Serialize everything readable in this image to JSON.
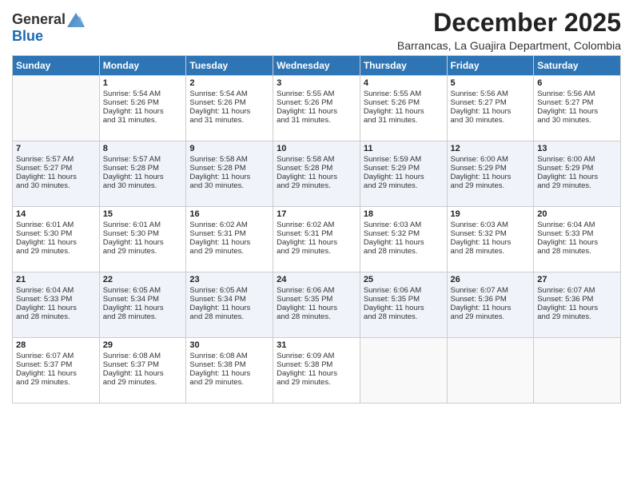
{
  "logo": {
    "general": "General",
    "blue": "Blue"
  },
  "title": "December 2025",
  "location": "Barrancas, La Guajira Department, Colombia",
  "days_header": [
    "Sunday",
    "Monday",
    "Tuesday",
    "Wednesday",
    "Thursday",
    "Friday",
    "Saturday"
  ],
  "weeks": [
    [
      {
        "day": "",
        "lines": []
      },
      {
        "day": "1",
        "lines": [
          "Sunrise: 5:54 AM",
          "Sunset: 5:26 PM",
          "Daylight: 11 hours",
          "and 31 minutes."
        ]
      },
      {
        "day": "2",
        "lines": [
          "Sunrise: 5:54 AM",
          "Sunset: 5:26 PM",
          "Daylight: 11 hours",
          "and 31 minutes."
        ]
      },
      {
        "day": "3",
        "lines": [
          "Sunrise: 5:55 AM",
          "Sunset: 5:26 PM",
          "Daylight: 11 hours",
          "and 31 minutes."
        ]
      },
      {
        "day": "4",
        "lines": [
          "Sunrise: 5:55 AM",
          "Sunset: 5:26 PM",
          "Daylight: 11 hours",
          "and 31 minutes."
        ]
      },
      {
        "day": "5",
        "lines": [
          "Sunrise: 5:56 AM",
          "Sunset: 5:27 PM",
          "Daylight: 11 hours",
          "and 30 minutes."
        ]
      },
      {
        "day": "6",
        "lines": [
          "Sunrise: 5:56 AM",
          "Sunset: 5:27 PM",
          "Daylight: 11 hours",
          "and 30 minutes."
        ]
      }
    ],
    [
      {
        "day": "7",
        "lines": [
          "Sunrise: 5:57 AM",
          "Sunset: 5:27 PM",
          "Daylight: 11 hours",
          "and 30 minutes."
        ]
      },
      {
        "day": "8",
        "lines": [
          "Sunrise: 5:57 AM",
          "Sunset: 5:28 PM",
          "Daylight: 11 hours",
          "and 30 minutes."
        ]
      },
      {
        "day": "9",
        "lines": [
          "Sunrise: 5:58 AM",
          "Sunset: 5:28 PM",
          "Daylight: 11 hours",
          "and 30 minutes."
        ]
      },
      {
        "day": "10",
        "lines": [
          "Sunrise: 5:58 AM",
          "Sunset: 5:28 PM",
          "Daylight: 11 hours",
          "and 29 minutes."
        ]
      },
      {
        "day": "11",
        "lines": [
          "Sunrise: 5:59 AM",
          "Sunset: 5:29 PM",
          "Daylight: 11 hours",
          "and 29 minutes."
        ]
      },
      {
        "day": "12",
        "lines": [
          "Sunrise: 6:00 AM",
          "Sunset: 5:29 PM",
          "Daylight: 11 hours",
          "and 29 minutes."
        ]
      },
      {
        "day": "13",
        "lines": [
          "Sunrise: 6:00 AM",
          "Sunset: 5:29 PM",
          "Daylight: 11 hours",
          "and 29 minutes."
        ]
      }
    ],
    [
      {
        "day": "14",
        "lines": [
          "Sunrise: 6:01 AM",
          "Sunset: 5:30 PM",
          "Daylight: 11 hours",
          "and 29 minutes."
        ]
      },
      {
        "day": "15",
        "lines": [
          "Sunrise: 6:01 AM",
          "Sunset: 5:30 PM",
          "Daylight: 11 hours",
          "and 29 minutes."
        ]
      },
      {
        "day": "16",
        "lines": [
          "Sunrise: 6:02 AM",
          "Sunset: 5:31 PM",
          "Daylight: 11 hours",
          "and 29 minutes."
        ]
      },
      {
        "day": "17",
        "lines": [
          "Sunrise: 6:02 AM",
          "Sunset: 5:31 PM",
          "Daylight: 11 hours",
          "and 29 minutes."
        ]
      },
      {
        "day": "18",
        "lines": [
          "Sunrise: 6:03 AM",
          "Sunset: 5:32 PM",
          "Daylight: 11 hours",
          "and 28 minutes."
        ]
      },
      {
        "day": "19",
        "lines": [
          "Sunrise: 6:03 AM",
          "Sunset: 5:32 PM",
          "Daylight: 11 hours",
          "and 28 minutes."
        ]
      },
      {
        "day": "20",
        "lines": [
          "Sunrise: 6:04 AM",
          "Sunset: 5:33 PM",
          "Daylight: 11 hours",
          "and 28 minutes."
        ]
      }
    ],
    [
      {
        "day": "21",
        "lines": [
          "Sunrise: 6:04 AM",
          "Sunset: 5:33 PM",
          "Daylight: 11 hours",
          "and 28 minutes."
        ]
      },
      {
        "day": "22",
        "lines": [
          "Sunrise: 6:05 AM",
          "Sunset: 5:34 PM",
          "Daylight: 11 hours",
          "and 28 minutes."
        ]
      },
      {
        "day": "23",
        "lines": [
          "Sunrise: 6:05 AM",
          "Sunset: 5:34 PM",
          "Daylight: 11 hours",
          "and 28 minutes."
        ]
      },
      {
        "day": "24",
        "lines": [
          "Sunrise: 6:06 AM",
          "Sunset: 5:35 PM",
          "Daylight: 11 hours",
          "and 28 minutes."
        ]
      },
      {
        "day": "25",
        "lines": [
          "Sunrise: 6:06 AM",
          "Sunset: 5:35 PM",
          "Daylight: 11 hours",
          "and 28 minutes."
        ]
      },
      {
        "day": "26",
        "lines": [
          "Sunrise: 6:07 AM",
          "Sunset: 5:36 PM",
          "Daylight: 11 hours",
          "and 29 minutes."
        ]
      },
      {
        "day": "27",
        "lines": [
          "Sunrise: 6:07 AM",
          "Sunset: 5:36 PM",
          "Daylight: 11 hours",
          "and 29 minutes."
        ]
      }
    ],
    [
      {
        "day": "28",
        "lines": [
          "Sunrise: 6:07 AM",
          "Sunset: 5:37 PM",
          "Daylight: 11 hours",
          "and 29 minutes."
        ]
      },
      {
        "day": "29",
        "lines": [
          "Sunrise: 6:08 AM",
          "Sunset: 5:37 PM",
          "Daylight: 11 hours",
          "and 29 minutes."
        ]
      },
      {
        "day": "30",
        "lines": [
          "Sunrise: 6:08 AM",
          "Sunset: 5:38 PM",
          "Daylight: 11 hours",
          "and 29 minutes."
        ]
      },
      {
        "day": "31",
        "lines": [
          "Sunrise: 6:09 AM",
          "Sunset: 5:38 PM",
          "Daylight: 11 hours",
          "and 29 minutes."
        ]
      },
      {
        "day": "",
        "lines": []
      },
      {
        "day": "",
        "lines": []
      },
      {
        "day": "",
        "lines": []
      }
    ]
  ]
}
